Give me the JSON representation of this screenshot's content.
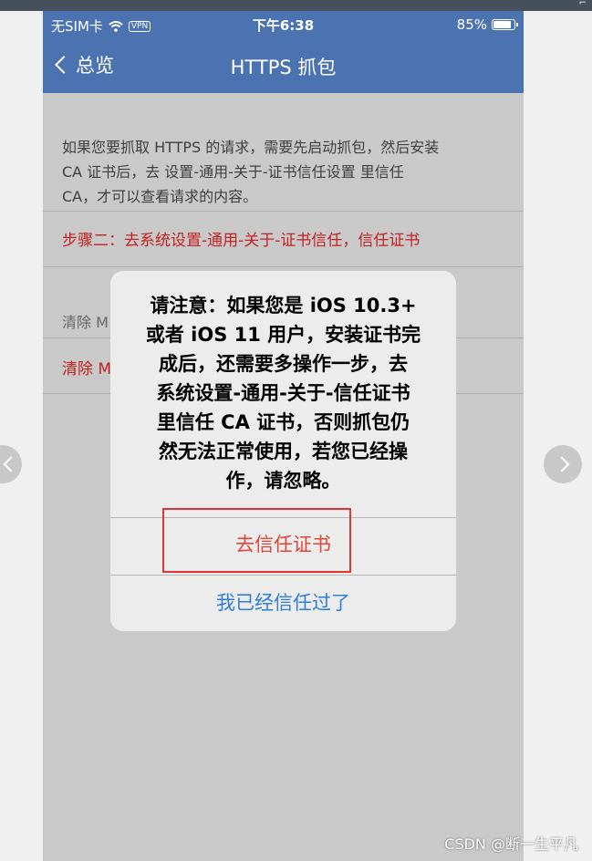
{
  "status_bar": {
    "carrier": "无SIM卡",
    "vpn": "VPN",
    "time": "下午6:38",
    "battery": "85%",
    "battery_level": 0.85
  },
  "nav": {
    "back_label": "总览",
    "title": "HTTPS 抓包"
  },
  "content": {
    "info_lines": [
      "如果您要抓取 HTTPS 的请求，需要先启动抓包，然后安装",
      "CA 证书后，去 设置-通用-关于-证书信任设置 里信任",
      "CA，才可以查看请求的内容。"
    ],
    "step2": "步骤二：去系统设置-通用-关于-证书信任，信任证书",
    "section_label": "清除 M",
    "clear_item": "清除 M"
  },
  "alert": {
    "message_lines": [
      "请注意：如果您是 iOS 10.3+",
      "或者  iOS 11 用户，安装证书完",
      "成后，还需要多操作一步，去",
      "系统设置-通用-关于-信任证书",
      "里信任 CA 证书，否则抓包仍",
      "然无法正常使用，若您已经操",
      "作，请忽略。"
    ],
    "trust_button": "去信任证书",
    "already_button": "我已经信任过了"
  },
  "watermark": "CSDN @断一生平凡",
  "colors": {
    "nav_blue": "#4c73b1",
    "warning_red": "#c42020",
    "alert_red": "#e0453a",
    "alert_blue": "#2f7ed8"
  }
}
